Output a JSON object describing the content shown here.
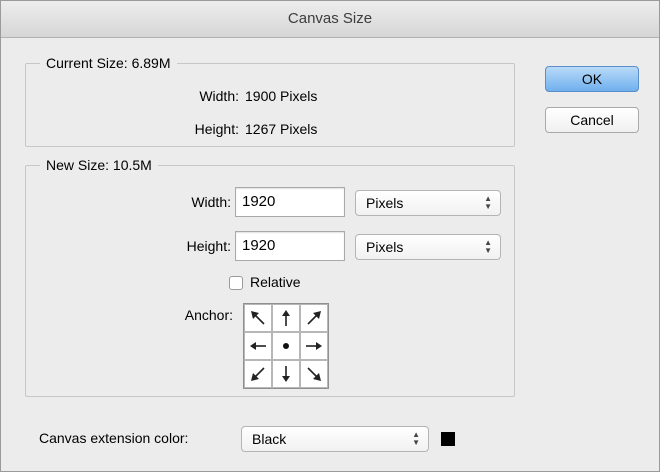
{
  "window": {
    "title": "Canvas Size"
  },
  "current_size": {
    "legend": "Current Size: 6.89M",
    "width_label": "Width:",
    "width_value": "1900 Pixels",
    "height_label": "Height:",
    "height_value": "1267 Pixels"
  },
  "new_size": {
    "legend": "New Size: 10.5M",
    "width_label": "Width:",
    "width_value": "1920",
    "width_unit": "Pixels",
    "height_label": "Height:",
    "height_value": "1920",
    "height_unit": "Pixels",
    "relative_label": "Relative",
    "relative_checked": false,
    "anchor_label": "Anchor:",
    "anchor_cells": [
      {
        "icon": "arrow-nw-icon"
      },
      {
        "icon": "arrow-n-icon"
      },
      {
        "icon": "arrow-ne-icon"
      },
      {
        "icon": "arrow-w-icon"
      },
      {
        "icon": "anchor-center-dot-icon"
      },
      {
        "icon": "arrow-e-icon"
      },
      {
        "icon": "arrow-sw-icon"
      },
      {
        "icon": "arrow-s-icon"
      },
      {
        "icon": "arrow-se-icon"
      }
    ]
  },
  "extension": {
    "label": "Canvas extension color:",
    "value": "Black",
    "swatch_color": "#000000"
  },
  "buttons": {
    "ok": "OK",
    "cancel": "Cancel"
  },
  "colors": {
    "default_button": "#6fb0ee",
    "group_border": "#c7c7c7"
  }
}
